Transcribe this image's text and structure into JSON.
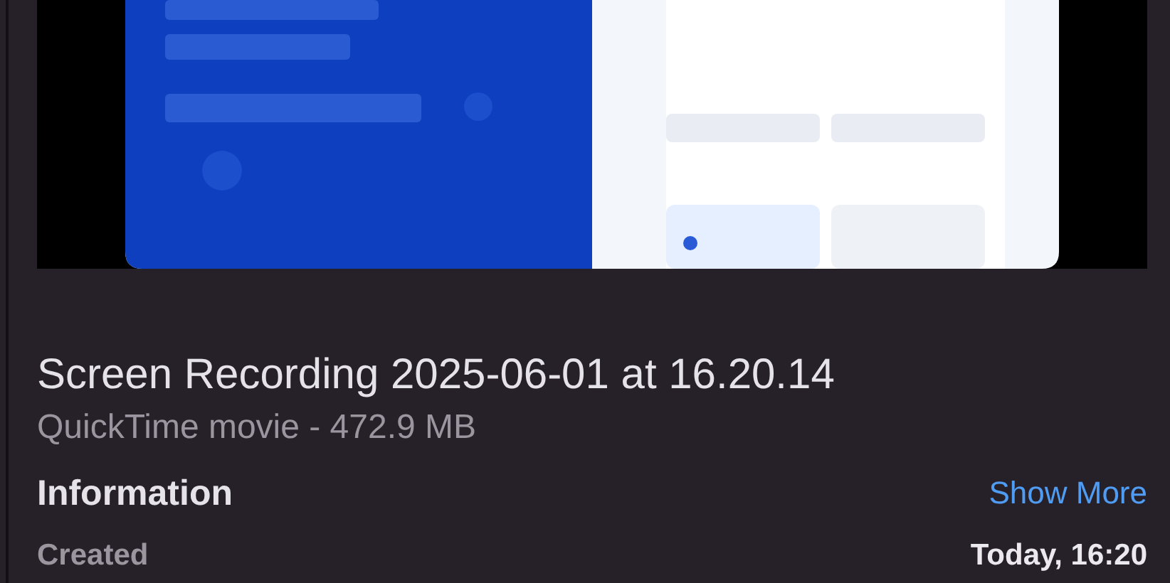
{
  "file": {
    "name": "Screen Recording 2025-06-01 at 16.20.14",
    "details": "QuickTime movie - 472.9 MB"
  },
  "information": {
    "heading": "Information",
    "show_more": "Show More",
    "rows": [
      {
        "label": "Created",
        "value": "Today, 16:20"
      }
    ]
  }
}
